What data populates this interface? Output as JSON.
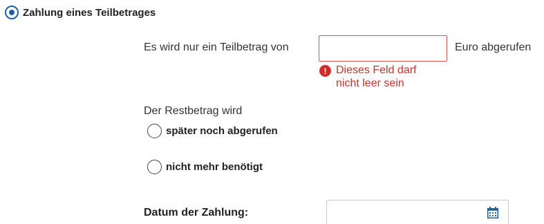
{
  "payment_option": {
    "label": "Zahlung eines Teilbetrages",
    "selected": true
  },
  "partial_amount": {
    "prefix": "Es wird nur ein Teilbetrag von",
    "value": "",
    "suffix": "Euro abgerufen",
    "error": "Dieses Feld darf nicht leer sein",
    "error_icon": "exclamation-circle-icon"
  },
  "remaining": {
    "label": "Der Restbetrag wird",
    "options": [
      {
        "label": "später noch abgerufen",
        "selected": false
      },
      {
        "label": "nicht mehr benötigt",
        "selected": false
      }
    ]
  },
  "date": {
    "label": "Datum der Zahlung:",
    "value": "",
    "icon": "calendar-icon"
  },
  "colors": {
    "accent": "#1e5fa8",
    "error": "#c9302c",
    "error_border": "#d9534f"
  }
}
